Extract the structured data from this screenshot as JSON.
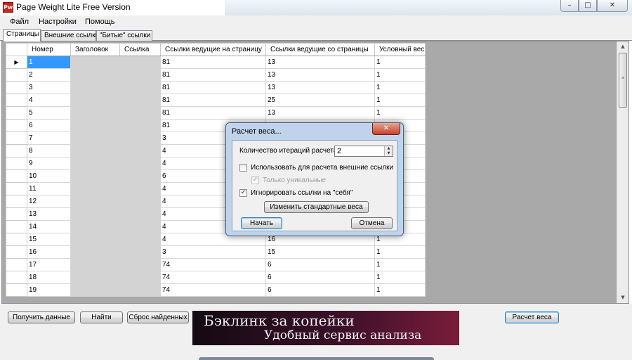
{
  "window": {
    "title": "Page Weight Lite Free Version",
    "icon_text": "Pw",
    "buttons": {
      "minimize": "–",
      "maximize": "□",
      "close": "✕"
    }
  },
  "menu": [
    "Файл",
    "Настройки",
    "Помощь"
  ],
  "tabs": [
    "Страницы",
    "Внешние ссылки",
    "\"Битые\" ссылки"
  ],
  "table": {
    "columns": [
      "Номер",
      "Заголовок",
      "Ссылка",
      "Ссылки ведущие на страницу",
      "Ссылки ведущие со страницы",
      "Условный вес"
    ],
    "rows": [
      [
        "1",
        "",
        "",
        "81",
        "13",
        "1"
      ],
      [
        "2",
        "",
        "",
        "81",
        "13",
        "1"
      ],
      [
        "3",
        "",
        "",
        "81",
        "13",
        "1"
      ],
      [
        "4",
        "",
        "",
        "81",
        "25",
        "1"
      ],
      [
        "5",
        "",
        "",
        "81",
        "13",
        "1"
      ],
      [
        "6",
        "",
        "",
        "81",
        "",
        ""
      ],
      [
        "7",
        "",
        "",
        "3",
        "",
        ""
      ],
      [
        "8",
        "",
        "",
        "4",
        "",
        ""
      ],
      [
        "9",
        "",
        "",
        "4",
        "",
        ""
      ],
      [
        "10",
        "",
        "",
        "6",
        "",
        ""
      ],
      [
        "11",
        "",
        "",
        "4",
        "",
        ""
      ],
      [
        "12",
        "",
        "",
        "4",
        "",
        ""
      ],
      [
        "13",
        "",
        "",
        "4",
        "",
        ""
      ],
      [
        "14",
        "",
        "",
        "4",
        "",
        ""
      ],
      [
        "15",
        "",
        "",
        "4",
        "16",
        "1"
      ],
      [
        "16",
        "",
        "",
        "3",
        "15",
        "1"
      ],
      [
        "17",
        "",
        "",
        "74",
        "6",
        "1"
      ],
      [
        "18",
        "",
        "",
        "74",
        "6",
        "1"
      ],
      [
        "19",
        "",
        "",
        "74",
        "6",
        "1"
      ]
    ],
    "selected_row_indicator": "▶"
  },
  "scrollbar": {
    "up": "▲",
    "down": "▼",
    "grip": "≡"
  },
  "toolbar": {
    "get_data": "Получить данные",
    "find": "Найти",
    "reset_found": "Сброс найденных",
    "calc_weight": "Расчет веса"
  },
  "banner": {
    "line1": "Бэклинк за копейки",
    "line2": "Удобный сервис анализа ссылок"
  },
  "dialog": {
    "title": "Расчет веса...",
    "close": "✕",
    "iterations_label": "Количество итераций расчета:",
    "iterations_value": "2",
    "use_external_label": "Использовать для расчета внешние ссылки",
    "use_external_checked": false,
    "only_unique_label": "Только уникальные",
    "only_unique_checked": true,
    "only_unique_enabled": false,
    "ignore_self_label": "Игнорировать ссылки на \"себя\"",
    "ignore_self_checked": true,
    "change_weights": "Изменить стандартные веса",
    "start": "Начать",
    "cancel": "Отмена",
    "check_glyph": "✓"
  }
}
